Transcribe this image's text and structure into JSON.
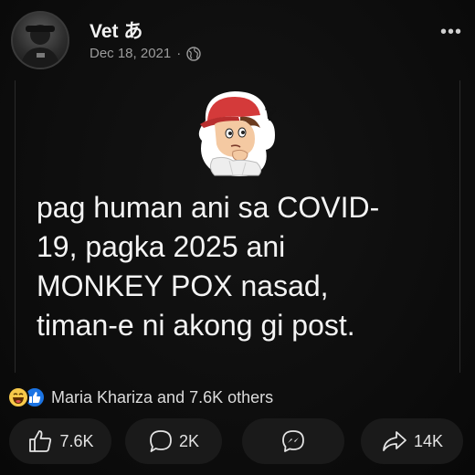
{
  "post": {
    "author": "Vet あ",
    "date": "Dec 18, 2021",
    "separator": "·",
    "privacy_icon": "globe-icon",
    "more_label": "•••",
    "text": "pag human ani sa COVID-\n19, pagka 2025 ani\nMONKEY POX nasad,\ntiman-e ni akong gi post."
  },
  "reactions": {
    "icons": [
      "haha-reaction-icon",
      "like-reaction-icon"
    ],
    "summary": "Maria Khariza and 7.6K others"
  },
  "actions": {
    "like": {
      "icon": "thumbs-up-icon",
      "count": "7.6K"
    },
    "comment": {
      "icon": "comment-bubble-icon",
      "count": "2K"
    },
    "messenger": {
      "icon": "messenger-icon"
    },
    "share": {
      "icon": "share-arrow-icon",
      "count": "14K"
    }
  },
  "colors": {
    "background": "#0c0c0c",
    "text": "#f4f4f4",
    "muted": "#9c9c9c",
    "button_bg": "#1a1a1a",
    "haha": "#f7c94a",
    "like": "#1b74e4"
  }
}
